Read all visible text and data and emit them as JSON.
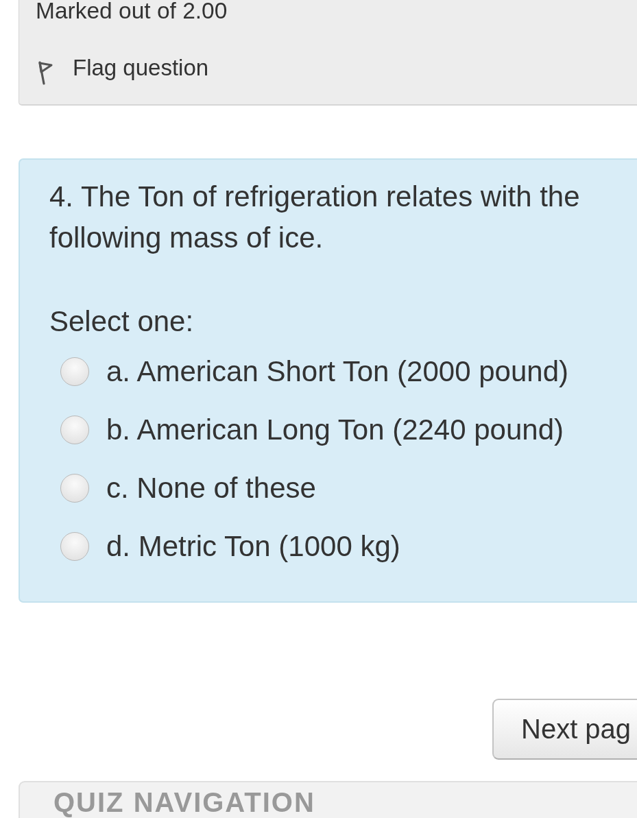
{
  "info": {
    "marks": "Marked out of 2.00",
    "flag_label": "Flag question",
    "flagged": false
  },
  "question": {
    "text": "4. The Ton of refrigeration relates with the following mass of ice.",
    "prompt": "Select one:",
    "options": [
      {
        "label": "a. American Short Ton (2000 pound)",
        "selected": false
      },
      {
        "label": "b. American Long Ton (2240 pound)",
        "selected": false
      },
      {
        "label": "c. None of these",
        "selected": false
      },
      {
        "label": "d. Metric Ton (1000 kg)",
        "selected": false
      }
    ]
  },
  "next_button": {
    "label": "Next pag"
  },
  "quiz_navigation": {
    "title": "QUIZ NAVIGATION"
  }
}
